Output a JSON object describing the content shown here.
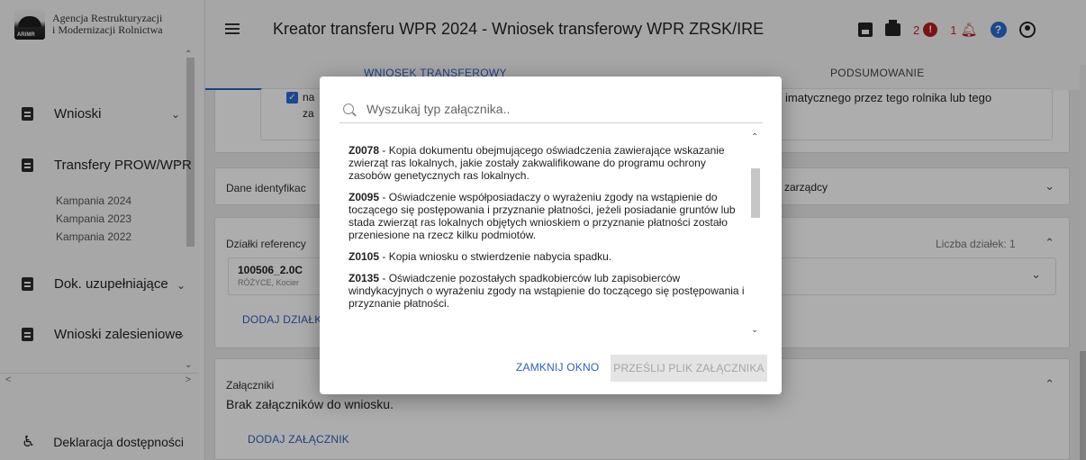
{
  "sidebar": {
    "logo_line1": "Agencja Restrukturyzacji",
    "logo_line2": "i Modernizacji Rolnictwa",
    "logo_mark": "ARiMR",
    "items": [
      {
        "label": "Wnioski"
      },
      {
        "label": "Transfery PROW/WPR"
      },
      {
        "label": "Dok. uzupełniające"
      },
      {
        "label": "Wnioski zalesieniowe"
      },
      {
        "label": "Deklaracja dostępności"
      }
    ],
    "subitems": [
      "Kampania 2024",
      "Kampania 2023",
      "Kampania 2022"
    ]
  },
  "header": {
    "title": "Kreator transferu WPR 2024 - Wniosek transferowy WPR ZRSK/IRE",
    "error_count": "2",
    "error_glyph": "!",
    "notif_count": "1",
    "help_glyph": "?"
  },
  "tabs": [
    {
      "label": "WNIOSEK TRANSFEROWY",
      "active": true
    },
    {
      "label": "PODSUMOWANIE",
      "active": false
    }
  ],
  "cards": {
    "top_fragment_left": "na",
    "top_fragment_left2": "za",
    "top_fragment_right": "imatycznego przez tego rolnika lub tego",
    "dane_title": "Dane identyfikac",
    "dane_right": "zarządcy",
    "dzialki_title": "Działki referency",
    "dzialki_count": "Liczba działek: 1",
    "dzialka_id": "100506_2.0C",
    "dzialka_loc": "RÓŻYCE, Kocier",
    "add_dzialka": "DODAJ DZIAŁK",
    "zal_title": "Załączniki",
    "zal_empty": "Brak załączników do wniosku.",
    "add_zal": "DODAJ ZAŁĄCZNIK"
  },
  "modal": {
    "search_placeholder": "Wyszukaj typ załącznika..",
    "attachments": [
      {
        "code": "Z0078",
        "text": " - Kopia dokumentu obejmującego oświadczenia zawierające wskazanie zwierząt ras lokalnych, jakie zostały zakwalifikowane do programu ochrony zasobów genetycznych ras lokalnych."
      },
      {
        "code": "Z0095",
        "text": " - Oświadczenie współposiadaczy o wyrażeniu zgody na wstąpienie do toczącego się postępowania i przyznanie płatności, jeżeli posiadanie gruntów lub stada zwierząt ras lokalnych objętych wnioskiem o przyznanie płatności zostało przeniesione na rzecz kilku podmiotów."
      },
      {
        "code": "Z0105",
        "text": " - Kopia wniosku o stwierdzenie nabycia spadku."
      },
      {
        "code": "Z0135",
        "text": " - Oświadczenie pozostałych spadkobierców lub zapisobierców windykacyjnych o wyrażeniu zgody na wstąpienie do toczącego się postępowania i przyznanie płatności."
      }
    ],
    "close_label": "ZAMKNIJ OKNO",
    "send_label": "PRZEŚLIJ PLIK ZAŁĄCZNIKA"
  },
  "colors": {
    "accent": "#2a5fc4",
    "error": "#b71c1c",
    "help": "#2a6bd6"
  }
}
